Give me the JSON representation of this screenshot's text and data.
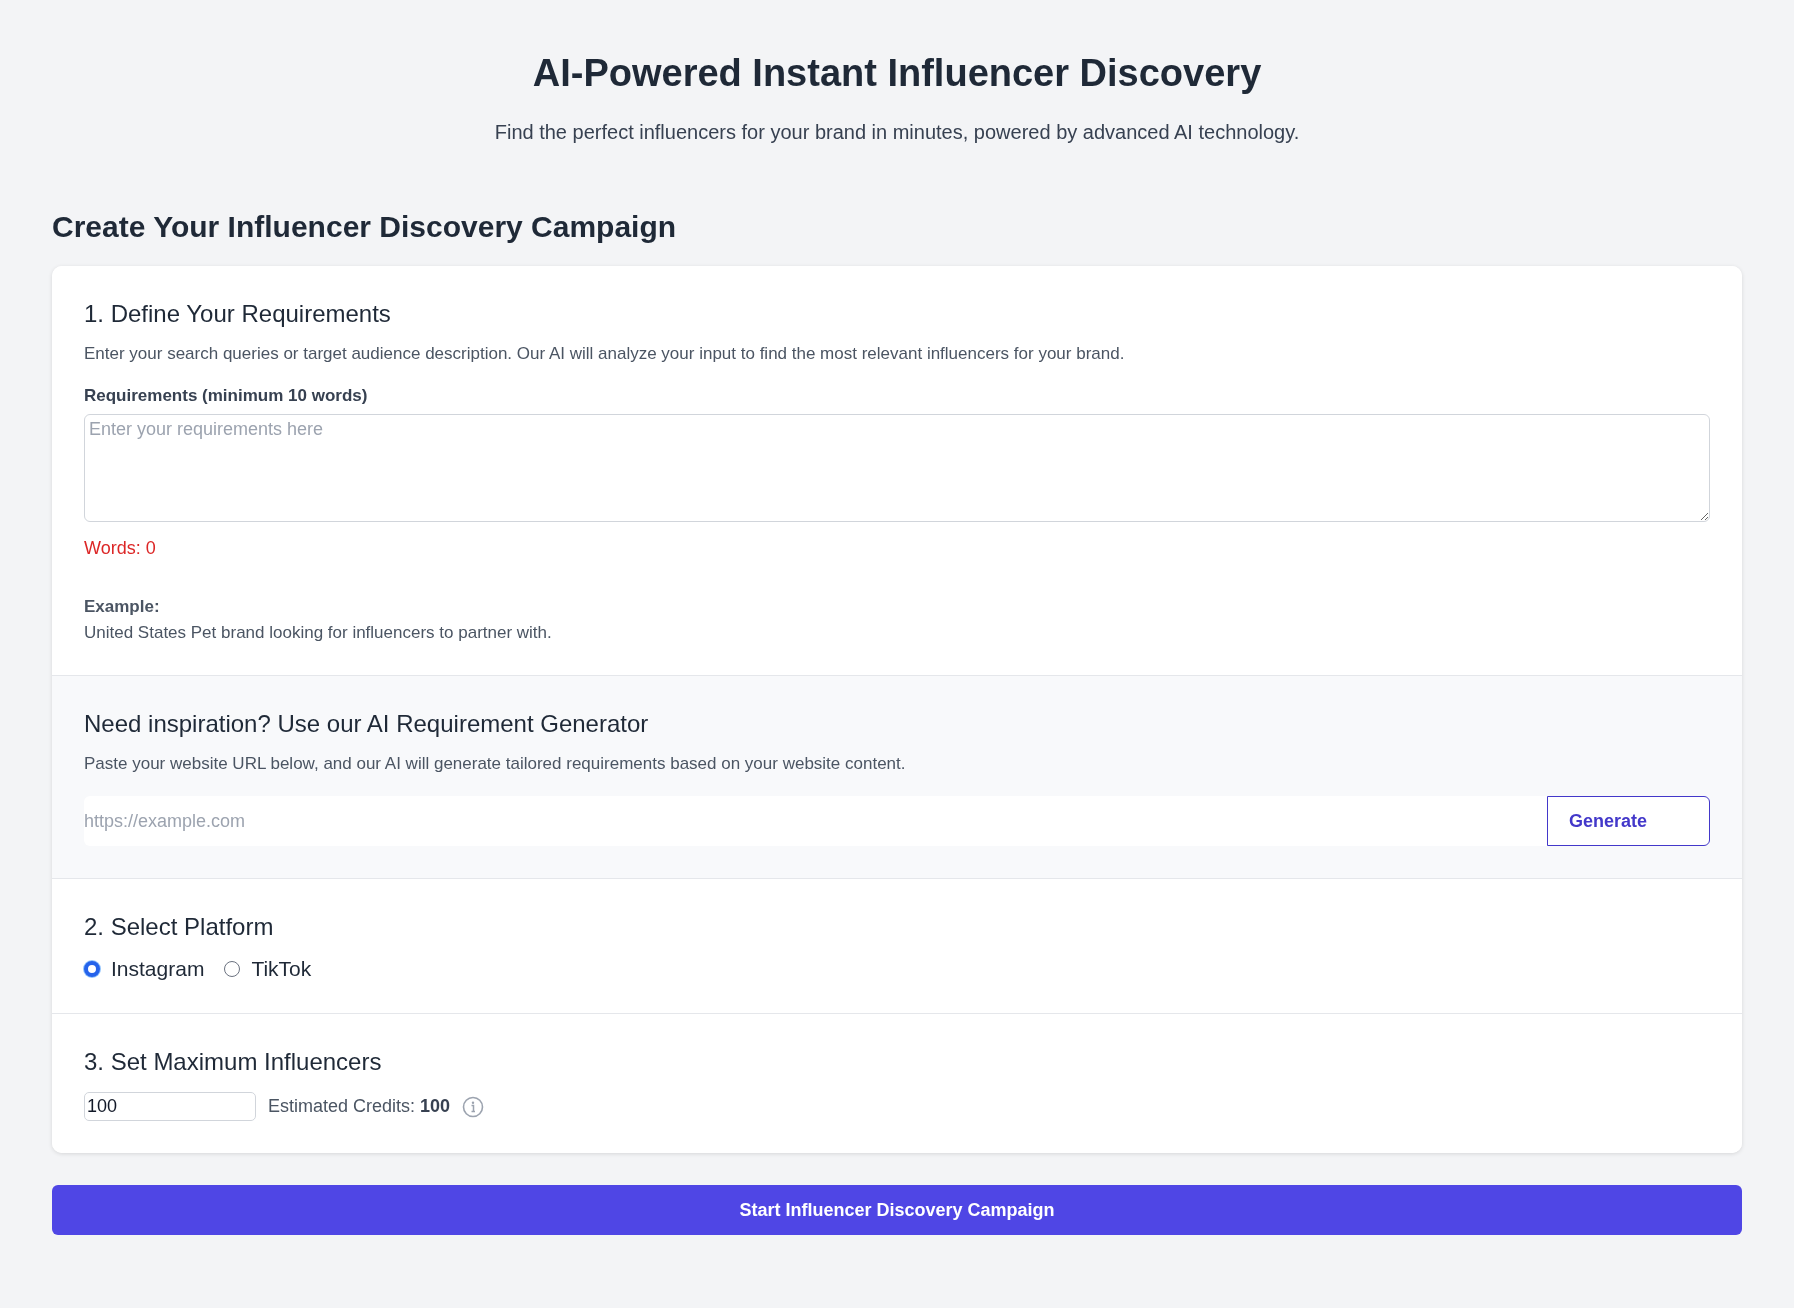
{
  "title": "AI-Powered Instant Influencer Discovery",
  "subtitle": "Find the perfect influencers for your brand in minutes, powered by advanced AI technology.",
  "campaign_heading": "Create Your Influencer Discovery Campaign",
  "requirements": {
    "heading": "1. Define Your Requirements",
    "description": "Enter your search queries or target audience description. Our AI will analyze your input to find the most relevant influencers for your brand.",
    "label": "Requirements (minimum 10 words)",
    "placeholder": "Enter your requirements here",
    "word_count": "Words: 0",
    "example_label": "Example:",
    "example_text": "United States Pet brand looking for influencers to partner with."
  },
  "generator": {
    "heading": "Need inspiration? Use our AI Requirement Generator",
    "description": "Paste your website URL below, and our AI will generate tailored requirements based on your website content.",
    "placeholder": "https://example.com",
    "button": "Generate"
  },
  "platform": {
    "heading": "2. Select Platform",
    "options": [
      {
        "label": "Instagram",
        "selected": true
      },
      {
        "label": "TikTok",
        "selected": false
      }
    ]
  },
  "maximum": {
    "heading": "3. Set Maximum Influencers",
    "value": "100",
    "credits": "Estimated Credits: **100**"
  },
  "submit_button": "Start Influencer Discovery Campaign"
}
